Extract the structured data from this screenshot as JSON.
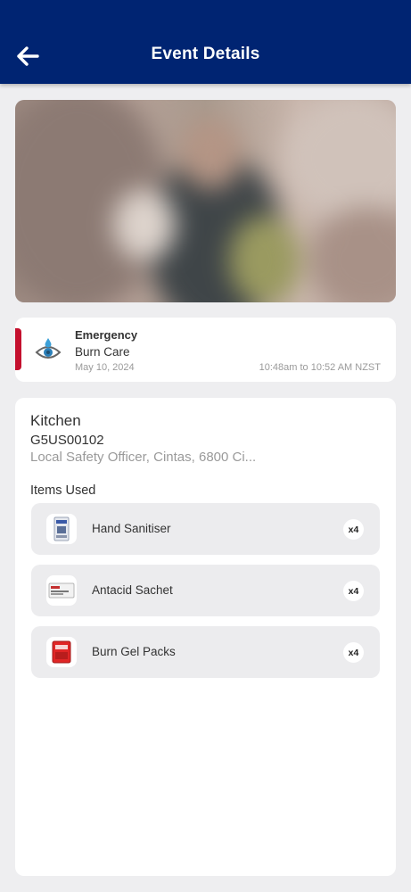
{
  "header": {
    "title": "Event Details",
    "background": "#002472"
  },
  "event": {
    "type": "Emergency",
    "subtype": "Burn Care",
    "date": "May 10, 2024",
    "time_range": "10:48am to 10:52 AM NZST",
    "accent_color": "#c4102e",
    "icon": "eye-drop-icon"
  },
  "details": {
    "location": "Kitchen",
    "code": "G5US00102",
    "officer": "Local Safety Officer, Cintas, 6800 Ci...",
    "items_title": "Items Used",
    "items": [
      {
        "name": "Hand Sanitiser",
        "qty": "x4",
        "icon": "sanitiser-packet-icon"
      },
      {
        "name": "Antacid Sachet",
        "qty": "x4",
        "icon": "antacid-sachet-icon"
      },
      {
        "name": "Burn Gel Packs",
        "qty": "x4",
        "icon": "burn-gel-pack-icon"
      }
    ]
  }
}
